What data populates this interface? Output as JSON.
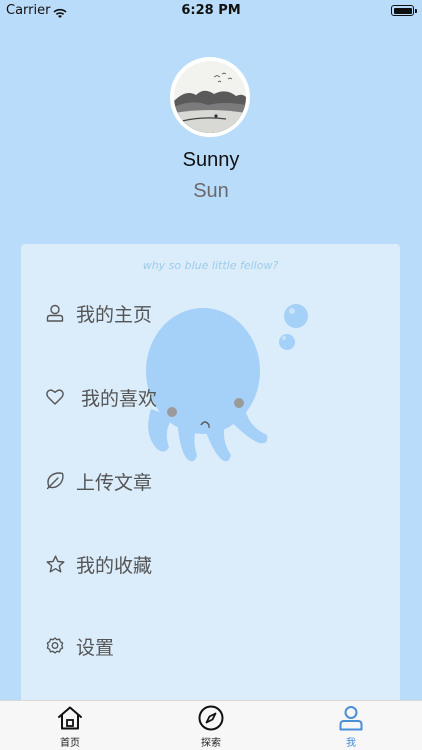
{
  "status_bar": {
    "carrier": "Carrier",
    "time": "6:28 PM"
  },
  "profile": {
    "username": "Sunny",
    "nickname": "Sun"
  },
  "card": {
    "tagline": "why so blue little fellow?"
  },
  "menu": {
    "items": [
      {
        "label": "我的主页",
        "icon": "person-icon"
      },
      {
        "label": "我的喜欢",
        "icon": "heart-icon"
      },
      {
        "label": "上传文章",
        "icon": "leaf-icon"
      },
      {
        "label": "我的收藏",
        "icon": "star-icon"
      },
      {
        "label": "设置",
        "icon": "gear-icon"
      }
    ]
  },
  "tabbar": {
    "tabs": [
      {
        "label": "首页",
        "icon": "home-icon"
      },
      {
        "label": "探索",
        "icon": "compass-icon"
      },
      {
        "label": "我",
        "icon": "person-icon"
      }
    ],
    "active_tab": "我"
  },
  "colors": {
    "background": "#b9dcfb",
    "card": "#dbecfb",
    "octopus": "#a5d0f7",
    "active_tab": "#4a8fd8"
  }
}
